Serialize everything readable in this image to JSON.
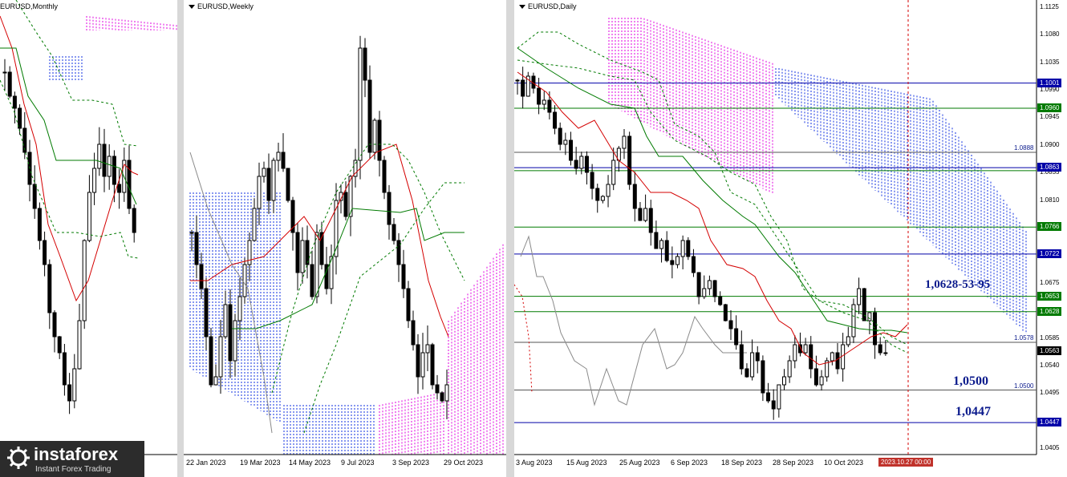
{
  "colors": {
    "tenkan": "#d40000",
    "kijun": "#007a00",
    "level_blue": "#0000a8",
    "level_green": "#007a00",
    "cloud_bear": "#e000e0",
    "cloud_bull": "#1030e0",
    "candle": "#000000",
    "chikou": "#8a8a8a",
    "date_badge": "#c0322b"
  },
  "panels": {
    "monthly": {
      "title": "EURUSD,Monthly"
    },
    "weekly": {
      "title": "EURUSD,Weekly",
      "x_labels": [
        "22 Jan 2023",
        "19 Mar 2023",
        "14 May 2023",
        "9 Jul 2023",
        "3 Sep 2023",
        "29 Oct 2023"
      ]
    },
    "daily": {
      "title": "EURUSD,Daily",
      "x_labels": [
        "3 Aug 2023",
        "15 Aug 2023",
        "25 Aug 2023",
        "6 Sep 2023",
        "18 Sep 2023",
        "28 Sep 2023",
        "10 Oct 2023"
      ],
      "cursor_date": "2023.10.27 00:00"
    }
  },
  "chart_data": [
    {
      "type": "candlestick",
      "title": "EURUSD,Monthly",
      "indicators": [
        "Ichimoku Kinko Hyo"
      ]
    },
    {
      "type": "candlestick",
      "title": "EURUSD,Weekly",
      "indicators": [
        "Ichimoku Kinko Hyo"
      ],
      "x": [
        "22 Jan 2023",
        "19 Mar 2023",
        "14 May 2023",
        "9 Jul 2023",
        "3 Sep 2023",
        "29 Oct 2023"
      ]
    },
    {
      "type": "candlestick",
      "title": "EURUSD,Daily",
      "indicators": [
        "Ichimoku Kinko Hyo"
      ],
      "x": [
        "3 Aug 2023",
        "15 Aug 2023",
        "25 Aug 2023",
        "6 Sep 2023",
        "18 Sep 2023",
        "28 Sep 2023",
        "10 Oct 2023"
      ],
      "y_ticks": [
        "1.1125",
        "1.1080",
        "1.1035",
        "1.0990",
        "1.0945",
        "1.0900",
        "1.0855",
        "1.0810",
        "1.0765",
        "1.0720",
        "1.0675",
        "1.0630",
        "1.0585",
        "1.0540",
        "1.0495",
        "1.0450",
        "1.0405"
      ],
      "ylim": [
        1.04,
        1.113
      ],
      "levels": [
        {
          "value": 1.1001,
          "label": "1.1001",
          "color": "#0000a8",
          "style": "solid"
        },
        {
          "value": 1.096,
          "label": "1.0960",
          "color": "#007a00",
          "style": "solid"
        },
        {
          "value": 1.0888,
          "label": "1.0888",
          "color": "#0000a8",
          "style": "plain"
        },
        {
          "value": 1.0863,
          "label": "1.0863",
          "color": "#0000a8",
          "style": "solid"
        },
        {
          "value": 1.0766,
          "label": "1.0766",
          "color": "#007a00",
          "style": "solid"
        },
        {
          "value": 1.0722,
          "label": "1.0722",
          "color": "#0000a8",
          "style": "solid"
        },
        {
          "value": 1.0653,
          "label": "1.0653",
          "color": "#007a00",
          "style": "solid"
        },
        {
          "value": 1.0628,
          "label": "1.0628",
          "color": "#007a00",
          "style": "solid"
        },
        {
          "value": 1.0578,
          "label": "1.0578",
          "color": "#555555",
          "style": "plain"
        },
        {
          "value": 1.0563,
          "label": "1.0563",
          "color": "#000000",
          "style": "current"
        },
        {
          "value": 1.05,
          "label": "1.0500",
          "color": "#000000",
          "style": "plain"
        },
        {
          "value": 1.0447,
          "label": "1.0447",
          "color": "#0000a8",
          "style": "solid"
        }
      ],
      "annotations": [
        "1,0628-53-95",
        "1,0500",
        "1,0447"
      ]
    }
  ],
  "logo": {
    "brand": "instaforex",
    "tagline": "Instant Forex Trading"
  }
}
